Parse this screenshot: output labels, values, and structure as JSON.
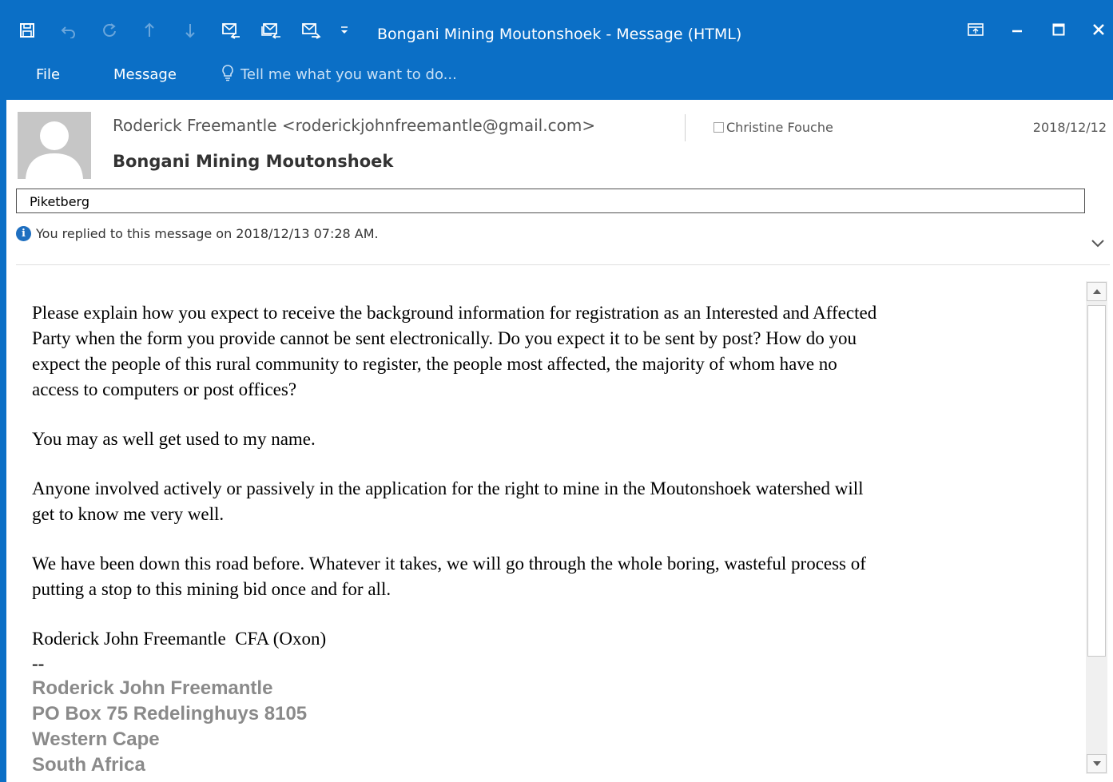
{
  "window": {
    "title": "Bongani Mining Moutonshoek - Message (HTML)",
    "accent_color": "#0b6fc6"
  },
  "quick_access": {
    "icons": [
      "save-icon",
      "undo-icon",
      "redo-icon",
      "previous-item-icon",
      "next-item-icon",
      "reply-icon",
      "reply-all-icon",
      "forward-icon",
      "customize-qat-icon"
    ]
  },
  "ribbon": {
    "tabs": [
      {
        "label": "File"
      },
      {
        "label": "Message"
      }
    ],
    "tell_me": "Tell me what you want to do..."
  },
  "message": {
    "from": "Roderick Freemantle <roderickjohnfreemantle@gmail.com>",
    "to": "Christine Fouche",
    "date": "2018/12/12",
    "subject": "Bongani Mining Moutonshoek",
    "category": "Piketberg",
    "info": "You replied to this message on 2018/12/13 07:28 AM."
  },
  "body": {
    "paragraph1_line1": "Please explain how you expect to receive the background information for registration as an Interested and Affected",
    "paragraph1_line2": "Party when the form you provide cannot be sent electronically. Do you expect it to be sent by post? How do you",
    "paragraph1_line3": "expect the people of this rural community to register, the people most affected, the majority of whom have no",
    "paragraph1_line4": "access to computers or post offices?",
    "paragraph2": "You may as well get used to my name.",
    "paragraph3_line1": "Anyone involved actively or passively in the application for the right to mine in the Moutonshoek watershed will",
    "paragraph3_line2": "get to know me very well.",
    "paragraph4_line1": "We have been down this road before. Whatever it takes, we will go through the whole boring, wasteful process of",
    "paragraph4_line2": "putting a stop to this mining bid once and for all.",
    "signoff": "Roderick John Freemantle  CFA (Oxon)",
    "separator": "--",
    "signature": [
      "Roderick John Freemantle",
      "PO Box 75 Redelinghuys 8105",
      "Western Cape",
      "South Africa"
    ]
  }
}
